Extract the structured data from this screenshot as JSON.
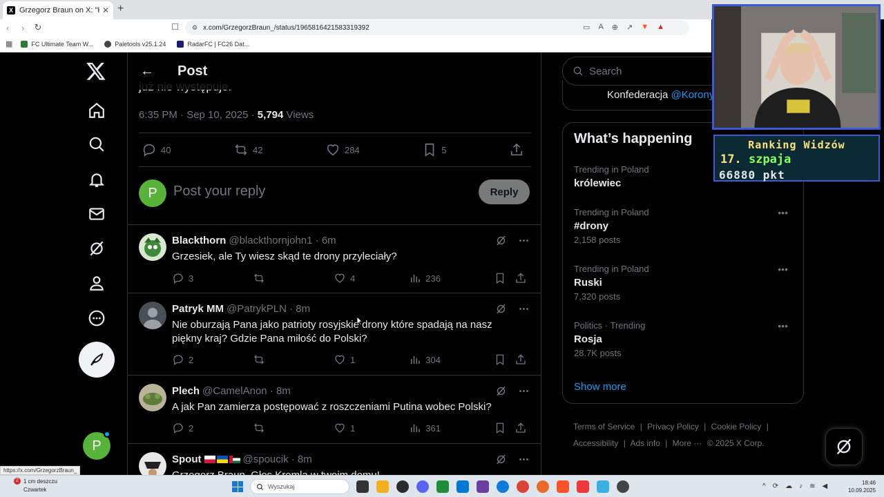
{
  "browser": {
    "tab_title": "Grzegorz Braun on X: \"Kto poch",
    "tab_favicon": "X",
    "url": "x.com/GrzegorzBraun_/status/1965816421583319392",
    "bookmarks": [
      {
        "label": "FC Ultimate Team W...",
        "color": "#2e7d32"
      },
      {
        "label": "Paletools v25.1.24",
        "color": "#444444"
      },
      {
        "label": "RadarFC | FC26 Dat...",
        "color": "#1a1a6e"
      }
    ],
    "status_url": "https://x.com/GrzegorzBraun_"
  },
  "nav": {
    "me_initial": "P"
  },
  "main": {
    "title": "Post",
    "cut_text": "już nie występuje.",
    "time": "6:35 PM · Sep 10, 2025 · ",
    "views_count": "5,794",
    "views_label": " Views",
    "stats": {
      "replies": "40",
      "reposts": "42",
      "likes": "284",
      "bookmarks": "5"
    },
    "reply_initial": "P",
    "reply_placeholder": "Post your reply",
    "reply_button": "Reply"
  },
  "replies": [
    {
      "name": "Blackthorn",
      "handle": "@blackthornjohn1 · 6m",
      "text": "Grzesiek, ale Ty wiesz skąd te drony przyleciały?",
      "replies": "3",
      "reposts": "",
      "likes": "4",
      "views": "236"
    },
    {
      "name": "Patryk MM",
      "handle": "@PatrykPLN · 8m",
      "text": "Nie oburzają Pana jako patrioty rosyjskie drony które spadają na nasz piękny kraj? Gdzie Pana miłość do Polski?",
      "replies": "2",
      "reposts": "",
      "likes": "1",
      "views": "304"
    },
    {
      "name": "Plech",
      "handle": "@CamelAnon · 8m",
      "text": "A jak Pan zamierza postępować z roszczeniami Putina wobec Polski?",
      "replies": "2",
      "reposts": "",
      "likes": "1",
      "views": "361"
    },
    {
      "name": "Spout",
      "handle": "@spoucik · 8m",
      "text": "Grzegorz Braun. Głos Kremla w twoim domu!"
    }
  ],
  "right": {
    "search_placeholder": "Search",
    "prev_card_text": "Konfederacja ",
    "prev_card_link": "@Korony",
    "trending_title": "What’s happening",
    "trends": [
      {
        "context": "Trending in Poland",
        "name": "królewiec",
        "count": ""
      },
      {
        "context": "Trending in Poland",
        "name": "#drony",
        "count": "2,158 posts"
      },
      {
        "context": "Trending in Poland",
        "name": "Ruski",
        "count": "7,320 posts"
      },
      {
        "context": "Politics · Trending",
        "name": "Rosja",
        "count": "28.7K posts"
      }
    ],
    "show_more": "Show more",
    "footer": [
      "Terms of Service",
      "|",
      "Privacy Policy",
      "|",
      "Cookie Policy",
      "|",
      "Accessibility",
      "|",
      "Ads info",
      "|",
      "More ···",
      "© 2025 X Corp."
    ]
  },
  "overlay": {
    "rank_title": "Ranking Widzów",
    "rank_pos": "17.",
    "rank_user": "szpaja",
    "rank_points": "66880 pkt"
  },
  "taskbar": {
    "weather_badge": "2",
    "weather_line1": "1 cm deszczu",
    "weather_line2": "Czwartek",
    "search_placeholder": "Wyszukaj",
    "time": "18:46",
    "date": "10.09.2025"
  },
  "colors": {
    "accent": "#1d9bf0",
    "muted": "#71767b",
    "border": "#2f3336",
    "avatar_green": "#58b33a"
  }
}
